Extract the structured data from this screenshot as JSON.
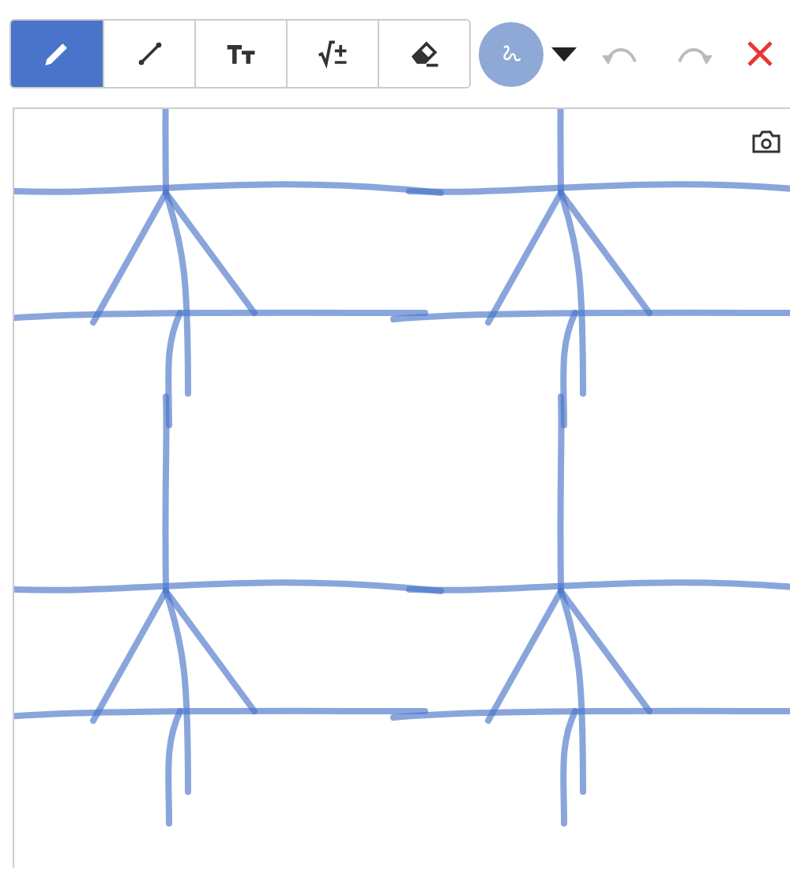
{
  "toolbar": {
    "tools": [
      {
        "kind": "pen",
        "selected": true
      },
      {
        "kind": "line",
        "selected": false
      },
      {
        "kind": "text",
        "selected": false
      },
      {
        "kind": "math",
        "selected": false
      },
      {
        "kind": "eraser",
        "selected": false
      }
    ],
    "undo": {
      "disabled": true
    },
    "redo": {
      "disabled": true
    }
  }
}
